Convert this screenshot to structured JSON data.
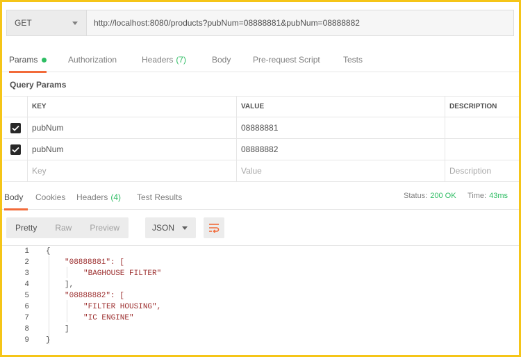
{
  "request": {
    "method": "GET",
    "url": "http://localhost:8080/products?pubNum=08888881&pubNum=08888882"
  },
  "request_tabs": [
    {
      "label": "Params",
      "active": true,
      "dot": true
    },
    {
      "label": "Authorization"
    },
    {
      "label": "Headers",
      "count": "(7)"
    },
    {
      "label": "Body"
    },
    {
      "label": "Pre-request Script"
    },
    {
      "label": "Tests"
    }
  ],
  "query_params": {
    "title": "Query Params",
    "columns": [
      "KEY",
      "VALUE",
      "DESCRIPTION"
    ],
    "rows": [
      {
        "checked": true,
        "key": "pubNum",
        "value": "08888881",
        "description": ""
      },
      {
        "checked": true,
        "key": "pubNum",
        "value": "08888882",
        "description": ""
      }
    ],
    "placeholders": {
      "key": "Key",
      "value": "Value",
      "description": "Description"
    }
  },
  "response_tabs": [
    {
      "label": "Body",
      "active": true
    },
    {
      "label": "Cookies"
    },
    {
      "label": "Headers",
      "count": "(4)"
    },
    {
      "label": "Test Results"
    }
  ],
  "status": {
    "status_label": "Status:",
    "status_value": "200 OK",
    "time_label": "Time:",
    "time_value": "43ms"
  },
  "view_modes": [
    "Pretty",
    "Raw",
    "Preview"
  ],
  "format": "JSON",
  "code_lines": [
    {
      "n": "1",
      "text": "{"
    },
    {
      "n": "2",
      "text": "\"08888881\": ["
    },
    {
      "n": "3",
      "text": "\"BAGHOUSE FILTER\""
    },
    {
      "n": "4",
      "text": "],"
    },
    {
      "n": "5",
      "text": "\"08888882\": ["
    },
    {
      "n": "6",
      "text": "\"FILTER HOUSING\","
    },
    {
      "n": "7",
      "text": "\"IC ENGINE\""
    },
    {
      "n": "8",
      "text": "]"
    },
    {
      "n": "9",
      "text": "}"
    }
  ],
  "colors": {
    "accent": "#f26b3a",
    "success": "#2ebd63",
    "string": "#9b2c2c",
    "frame": "#f5c518"
  }
}
